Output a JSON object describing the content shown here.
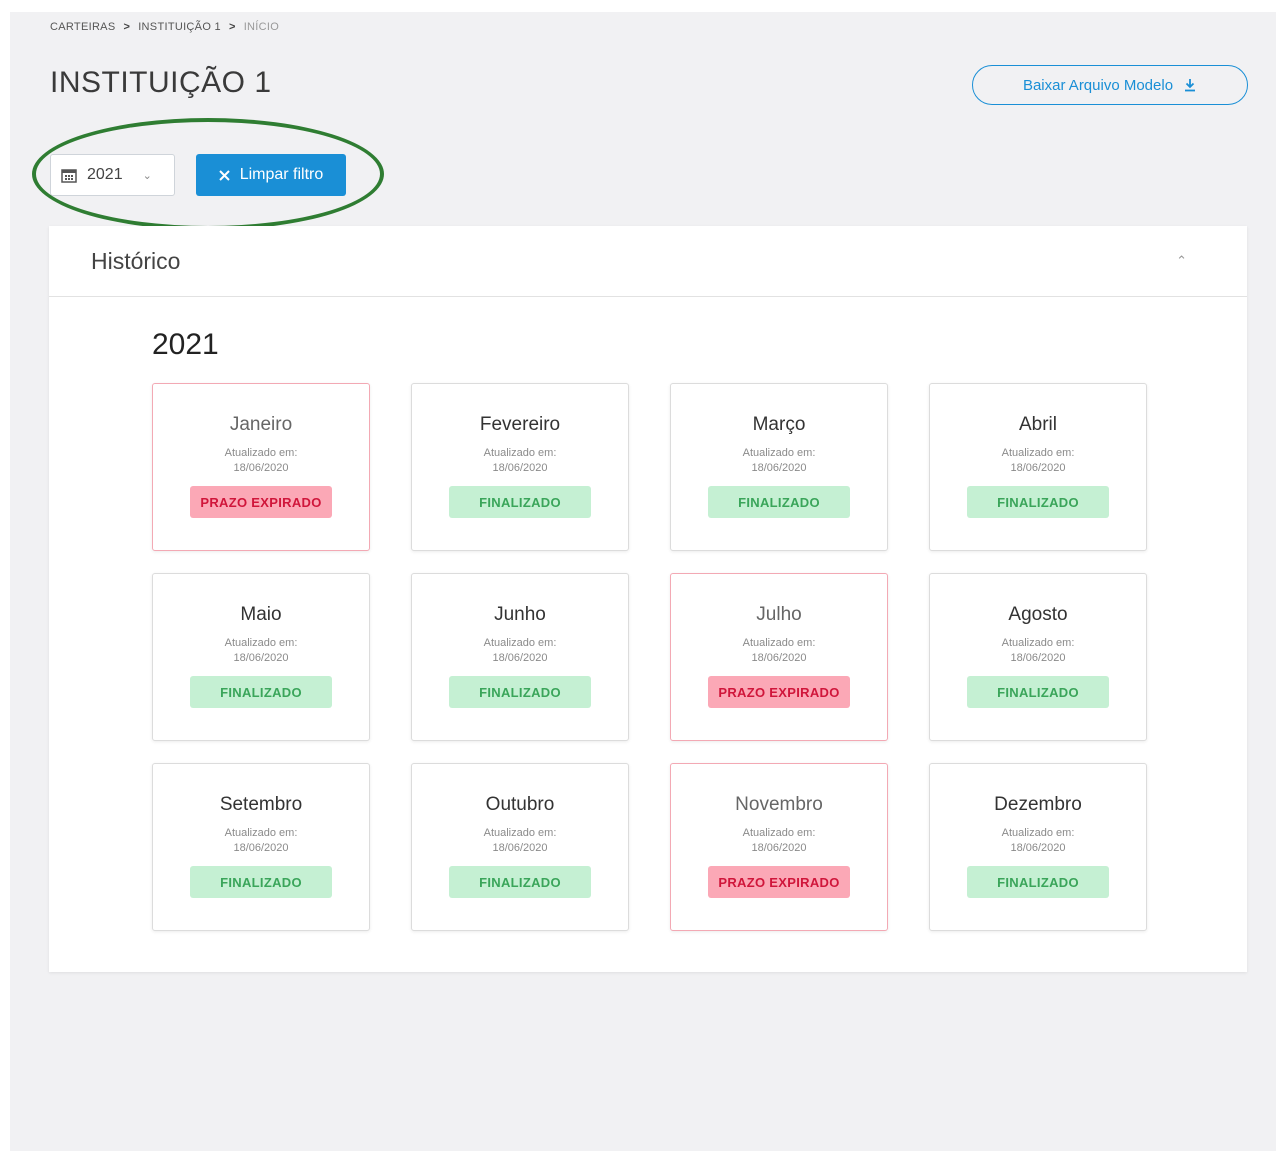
{
  "breadcrumb": {
    "items": [
      "CARTEIRAS",
      "INSTITUIÇÃO 1",
      "INÍCIO"
    ]
  },
  "page_title": "INSTITUIÇÃO 1",
  "download_button": {
    "label": "Baixar Arquivo Modelo",
    "icon": "download-icon"
  },
  "filter": {
    "year_value": "2021",
    "year_icon": "calendar-icon",
    "clear_label": "Limpar filtro",
    "clear_icon": "close-icon"
  },
  "history": {
    "title": "Histórico",
    "year": "2021",
    "months": [
      {
        "name": "Janeiro",
        "updated_label": "Atualizado em:",
        "updated_date": "18/06/2020",
        "status": "PRAZO EXPIRADO",
        "state": "expired"
      },
      {
        "name": "Fevereiro",
        "updated_label": "Atualizado em:",
        "updated_date": "18/06/2020",
        "status": "FINALIZADO",
        "state": "done"
      },
      {
        "name": "Março",
        "updated_label": "Atualizado em:",
        "updated_date": "18/06/2020",
        "status": "FINALIZADO",
        "state": "done"
      },
      {
        "name": "Abril",
        "updated_label": "Atualizado em:",
        "updated_date": "18/06/2020",
        "status": "FINALIZADO",
        "state": "done"
      },
      {
        "name": "Maio",
        "updated_label": "Atualizado em:",
        "updated_date": "18/06/2020",
        "status": "FINALIZADO",
        "state": "done"
      },
      {
        "name": "Junho",
        "updated_label": "Atualizado em:",
        "updated_date": "18/06/2020",
        "status": "FINALIZADO",
        "state": "done"
      },
      {
        "name": "Julho",
        "updated_label": "Atualizado em:",
        "updated_date": "18/06/2020",
        "status": "PRAZO EXPIRADO",
        "state": "expired"
      },
      {
        "name": "Agosto",
        "updated_label": "Atualizado em:",
        "updated_date": "18/06/2020",
        "status": "FINALIZADO",
        "state": "done"
      },
      {
        "name": "Setembro",
        "updated_label": "Atualizado em:",
        "updated_date": "18/06/2020",
        "status": "FINALIZADO",
        "state": "done"
      },
      {
        "name": "Outubro",
        "updated_label": "Atualizado em:",
        "updated_date": "18/06/2020",
        "status": "FINALIZADO",
        "state": "done"
      },
      {
        "name": "Novembro",
        "updated_label": "Atualizado em:",
        "updated_date": "18/06/2020",
        "status": "PRAZO EXPIRADO",
        "state": "expired"
      },
      {
        "name": "Dezembro",
        "updated_label": "Atualizado em:",
        "updated_date": "18/06/2020",
        "status": "FINALIZADO",
        "state": "done"
      }
    ]
  },
  "colors": {
    "accent": "#1a8fd6",
    "done_bg": "#c5f0d3",
    "done_text": "#3aa55a",
    "expired_bg": "#fba8b6",
    "expired_text": "#d0163b",
    "highlight": "#2f7d32"
  }
}
